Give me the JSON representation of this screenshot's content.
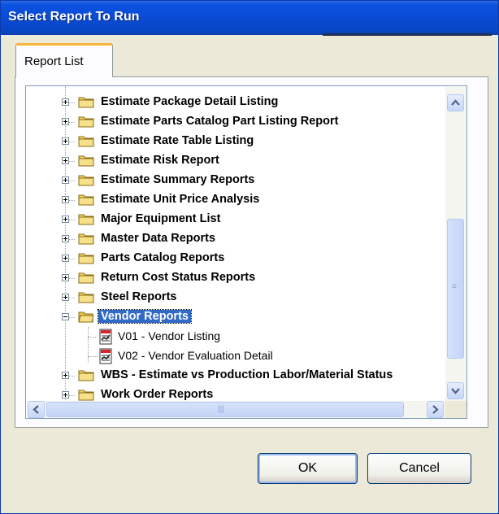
{
  "window": {
    "title": "Select Report To Run"
  },
  "tabs": [
    {
      "label": "Report List"
    }
  ],
  "tree": {
    "items": [
      {
        "label": "Estimate Package Detail Listing",
        "expanded": false
      },
      {
        "label": "Estimate Parts Catalog Part Listing Report",
        "expanded": false
      },
      {
        "label": "Estimate Rate Table Listing",
        "expanded": false
      },
      {
        "label": "Estimate Risk Report",
        "expanded": false
      },
      {
        "label": "Estimate Summary Reports",
        "expanded": false
      },
      {
        "label": "Estimate Unit Price Analysis",
        "expanded": false
      },
      {
        "label": "Major Equipment List",
        "expanded": false
      },
      {
        "label": "Master Data Reports",
        "expanded": false
      },
      {
        "label": "Parts Catalog Reports",
        "expanded": false
      },
      {
        "label": "Return Cost Status Reports",
        "expanded": false
      },
      {
        "label": "Steel Reports",
        "expanded": false
      },
      {
        "label": "Vendor Reports",
        "expanded": true,
        "selected": true,
        "children": [
          {
            "label": "V01 - Vendor Listing"
          },
          {
            "label": "V02 - Vendor Evaluation Detail"
          }
        ]
      },
      {
        "label": "WBS - Estimate vs Production Labor/Material Status",
        "expanded": false
      },
      {
        "label": "Work Order Reports",
        "expanded": false
      }
    ]
  },
  "buttons": {
    "ok": "OK",
    "cancel": "Cancel"
  },
  "icons": {
    "folder": "folder-icon",
    "open_folder": "open-folder-icon",
    "report": "report-icon",
    "expand": "plus-expander-icon",
    "collapse": "minus-expander-icon"
  },
  "colors": {
    "titlebar": "#0a4bd4",
    "selection": "#316ac5",
    "tab_accent": "#f5b53a",
    "folder": "#f3d36b"
  }
}
